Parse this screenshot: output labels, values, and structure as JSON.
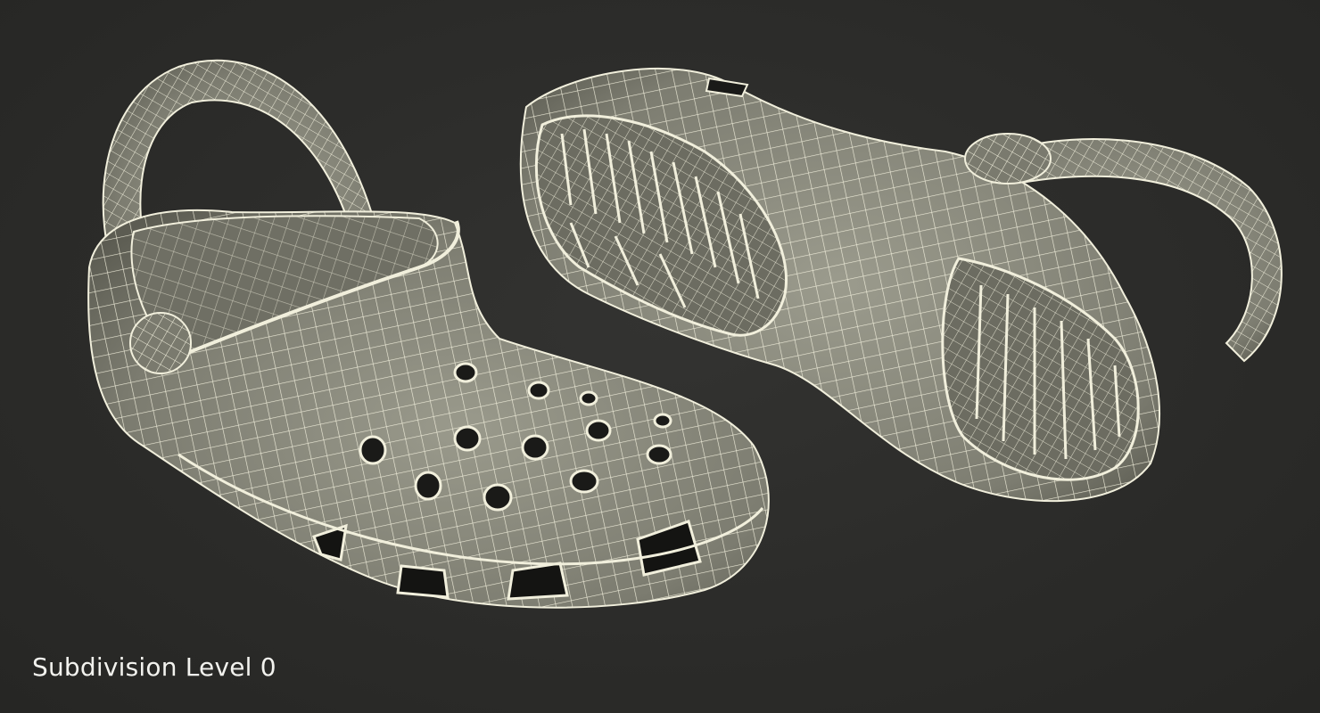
{
  "caption": "Subdivision Level 0",
  "colors": {
    "background": "#2c2c2a",
    "model_fill": "#8a8a7c",
    "model_shadow": "#5e5e54",
    "wireframe": "#f1efdc",
    "hole": "#1a1a18"
  }
}
